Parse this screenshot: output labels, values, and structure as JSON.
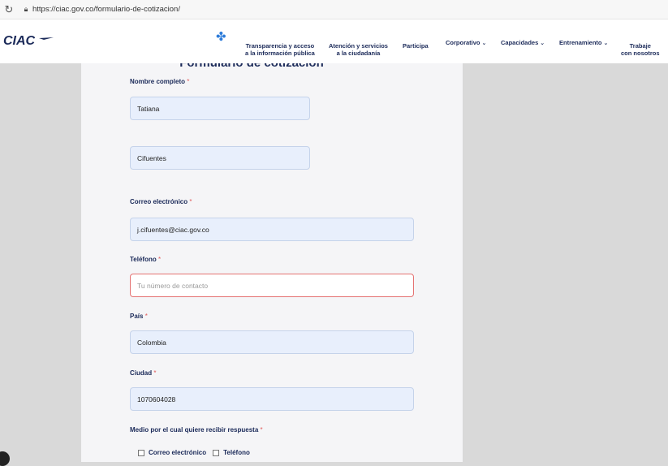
{
  "browser": {
    "reload_icon": "reload-icon",
    "lock_icon": "lock-icon",
    "url": "https://ciac.gov.co/formulario-de-cotizacion/"
  },
  "header": {
    "logo_text": "CIAC",
    "nav": {
      "transparencia_1": "Transparencia y acceso",
      "transparencia_2": "a la información pública",
      "atencion_1": "Atención y servicios",
      "atencion_2": "a la ciudadanía",
      "participa": "Participa",
      "corporativo": "Corporativo",
      "capacidades": "Capacidades",
      "entrenamiento": "Entrenamiento",
      "trabaje_1": "Trabaje",
      "trabaje_2": "con nosotros"
    }
  },
  "form": {
    "title": "Formulario de cotización",
    "required_mark": "*",
    "nombre_label": "Nombre completo",
    "nombre_value": "Tatiana",
    "apellido_value": "Cifuentes",
    "correo_label": "Correo electrónico",
    "correo_value": "j.cifuentes@ciac.gov.co",
    "telefono_label": "Teléfono",
    "telefono_placeholder": "Tu número de contacto",
    "pais_label": "País",
    "pais_value": "Colombia",
    "ciudad_label": "Ciudad",
    "ciudad_value": "1070604028",
    "medio_label": "Medio por el cual quiere recibir respuesta",
    "option_correo": "Correo electrónico",
    "option_telefono": "Teléfono"
  },
  "colors": {
    "brand_navy": "#1b2a59",
    "accent_blue": "#2c7bd9",
    "field_fill": "#e8effc",
    "error_border": "#e57373"
  }
}
